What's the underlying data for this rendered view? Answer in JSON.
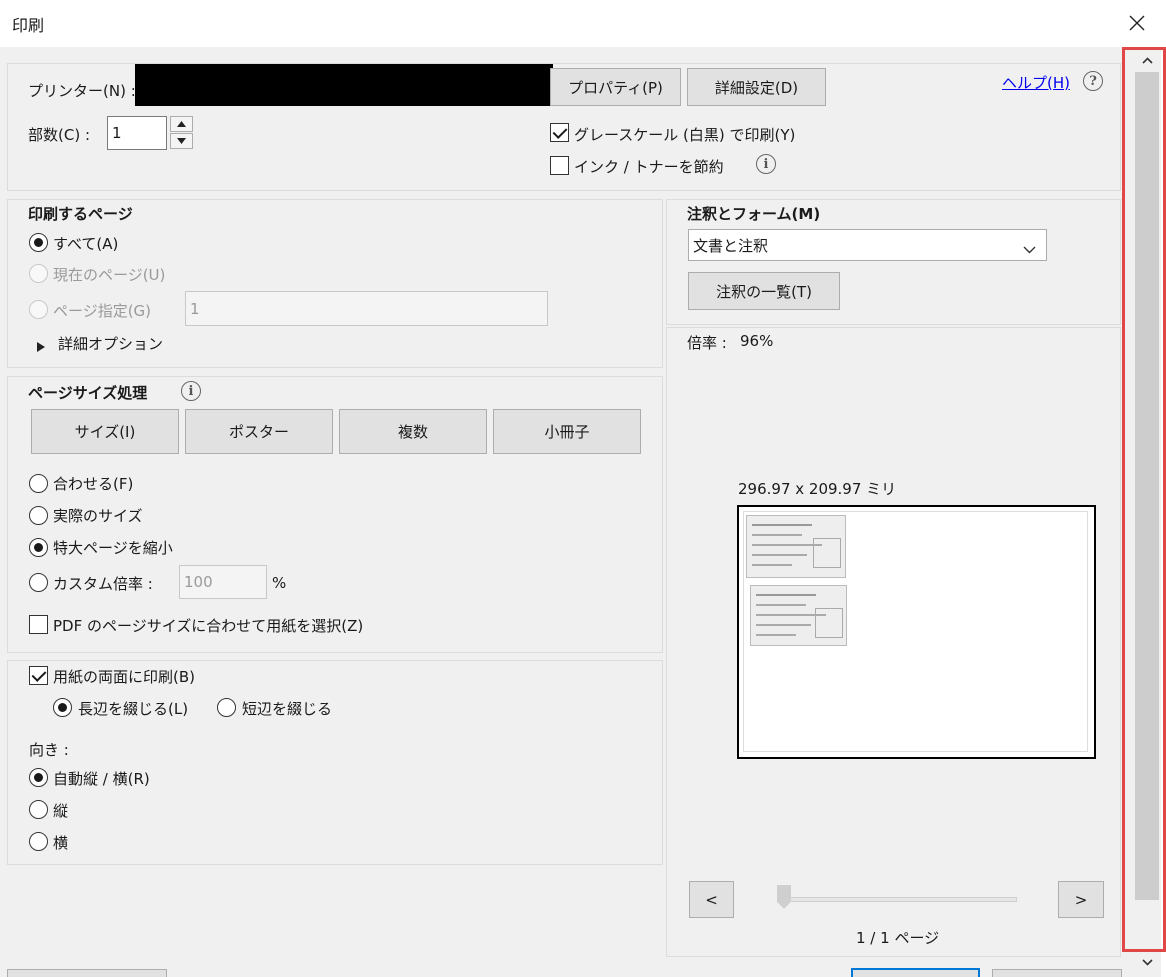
{
  "window": {
    "title": "印刷"
  },
  "printer": {
    "label": "プリンター(N) :",
    "properties_btn": "プロパティ(P)",
    "advanced_btn": "詳細設定(D)",
    "help_link": "ヘルプ(H)",
    "help_icon": "?"
  },
  "copies": {
    "label": "部数(C) :",
    "value": "1"
  },
  "options": {
    "grayscale": "グレースケール (白黒) で印刷(Y)",
    "grayscale_checked": true,
    "ink_save": "インク / トナーを節約",
    "ink_save_checked": false
  },
  "pages": {
    "heading": "印刷するページ",
    "all": "すべて(A)",
    "current": "現在のページ(U)",
    "range": "ページ指定(G)",
    "range_value": "1",
    "more_options": "詳細オプション"
  },
  "sizing": {
    "heading": "ページサイズ処理",
    "tabs": [
      "サイズ(I)",
      "ポスター",
      "複数",
      "小冊子"
    ],
    "fit": "合わせる(F)",
    "actual": "実際のサイズ",
    "shrink": "特大ページを縮小",
    "custom": "カスタム倍率 :",
    "custom_value": "100",
    "percent": "%",
    "pdf_paper": "PDF のページサイズに合わせて用紙を選択(Z)"
  },
  "duplex": {
    "label": "用紙の両面に印刷(B)",
    "checked": true,
    "long_edge": "長辺を綴じる(L)",
    "short_edge": "短辺を綴じる"
  },
  "orientation": {
    "heading": "向き :",
    "auto": "自動縦 / 横(R)",
    "portrait": "縦",
    "landscape": "横"
  },
  "annotations": {
    "heading": "注釈とフォーム(M)",
    "selected": "文書と注釈",
    "summary_btn": "注釈の一覧(T)"
  },
  "preview": {
    "zoom_label": "倍率 :",
    "zoom_value": "96%",
    "dimensions": "296.97 x 209.97 ミリ",
    "prev": "<",
    "next": ">",
    "page_indicator": "1 / 1 ページ"
  },
  "icons": {
    "close": "close-icon",
    "info": "info-icon",
    "dropdown": "chevron-down-icon",
    "spin_up": "caret-up-icon",
    "spin_down": "caret-down-icon",
    "expand": "triangle-right-icon"
  },
  "colors": {
    "highlight_box": "#e04848",
    "link": "#0000ee",
    "dialog_bg": "#f0f0f0"
  }
}
